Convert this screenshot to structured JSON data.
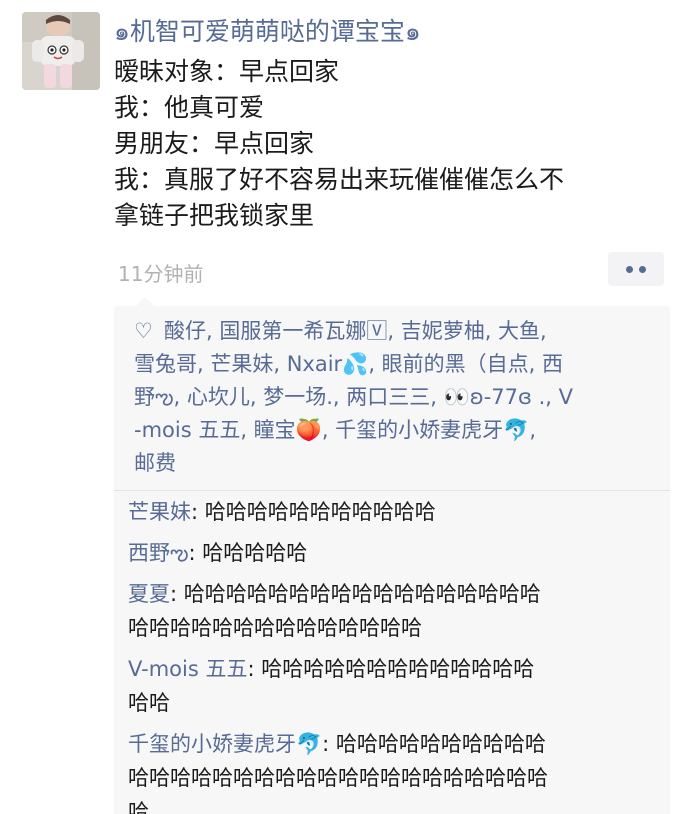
{
  "post": {
    "author": "๑机智可爱萌萌哒的谭宝宝๑",
    "lines": [
      "暧昧对象：早点回家",
      "我：他真可爱",
      "男朋友：早点回家",
      "我：真服了好不容易出来玩催催催怎么不",
      "拿链子把我锁家里"
    ],
    "time": "11分钟前",
    "more_icon": "more-dots-icon"
  },
  "likes": {
    "icon": "heart-outline-icon",
    "lines": [
      "酸仔, 国服第一希瓦娜🅅, 吉妮萝柚, 大鱼,",
      "雪兔哥, 芒果妹, Nxair💦, 眼前的黑（自点, 西",
      "野ఌ, 心坎儿, 梦一场., 两口三三, 👀ʚ-77ɞ ., V",
      "-mois 五五, 瞳宝🍑, 千玺的小娇妻虎牙🐬,",
      "邮费"
    ]
  },
  "comments": [
    {
      "name": "芒果妹",
      "lines": [
        "哈哈哈哈哈哈哈哈哈哈哈"
      ]
    },
    {
      "name": "西野ఌ",
      "lines": [
        "哈哈哈哈哈"
      ]
    },
    {
      "name": "夏夏",
      "lines": [
        "哈哈哈哈哈哈哈哈哈哈哈哈哈哈哈哈哈",
        "哈哈哈哈哈哈哈哈哈哈哈哈哈哈"
      ]
    },
    {
      "name": "V-mois 五五",
      "lines": [
        "哈哈哈哈哈哈哈哈哈哈哈哈哈",
        "哈哈"
      ]
    },
    {
      "name": "千玺的小娇妻虎牙🐬",
      "lines": [
        "哈哈哈哈哈哈哈哈哈哈",
        "哈哈哈哈哈哈哈哈哈哈哈哈哈哈哈哈哈哈哈哈",
        "哈"
      ]
    }
  ],
  "colors": {
    "link": "#576b95",
    "text": "#1b1b1b",
    "time": "#b2b2b2",
    "panel": "#f7f7f7"
  }
}
